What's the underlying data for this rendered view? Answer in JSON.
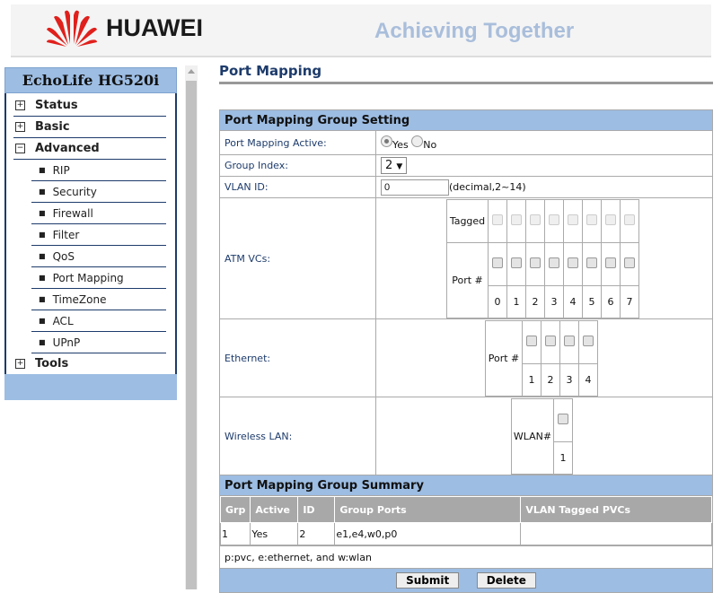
{
  "header": {
    "brand": "HUAWEI",
    "slogan": "Achieving Together",
    "brand_color": "#e0201c"
  },
  "sidebar": {
    "title": "EchoLife HG520i",
    "items": [
      {
        "label": "Status",
        "expand": "+"
      },
      {
        "label": "Basic",
        "expand": "+"
      },
      {
        "label": "Advanced",
        "expand": "−"
      }
    ],
    "subitems": [
      "RIP",
      "Security",
      "Firewall",
      "Filter",
      "QoS",
      "Port Mapping",
      "TimeZone",
      "ACL",
      "UPnP"
    ],
    "tools": {
      "label": "Tools",
      "expand": "+"
    }
  },
  "page": {
    "title": "Port Mapping"
  },
  "setting": {
    "title": "Port Mapping Group Setting",
    "active_label": "Port Mapping Active:",
    "yes": "Yes",
    "no": "No",
    "active": "Yes",
    "group_label": "Group Index:",
    "group_value": "2",
    "vlan_label": "VLAN ID:",
    "vlan_value": "0",
    "vlan_hint": "(decimal,2~14)",
    "atm_label": "ATM VCs:",
    "tagged": "Tagged",
    "port": "Port #",
    "atm_ports": [
      "0",
      "1",
      "2",
      "3",
      "4",
      "5",
      "6",
      "7"
    ],
    "eth_label": "Ethernet:",
    "eth_ports": [
      "1",
      "2",
      "3",
      "4"
    ],
    "wlan_label": "Wireless LAN:",
    "wlan": "WLAN#",
    "wlan_ports": [
      "1"
    ]
  },
  "summary": {
    "title": "Port Mapping Group Summary",
    "columns": [
      "Grp",
      "Active",
      "ID",
      "Group Ports",
      "VLAN Tagged PVCs"
    ],
    "rows": [
      [
        "1",
        "Yes",
        "2",
        "e1,e4,w0,p0",
        ""
      ]
    ],
    "note": "p:pvc, e:ethernet, and w:wlan"
  },
  "buttons": {
    "submit": "Submit",
    "delete": "Delete"
  }
}
